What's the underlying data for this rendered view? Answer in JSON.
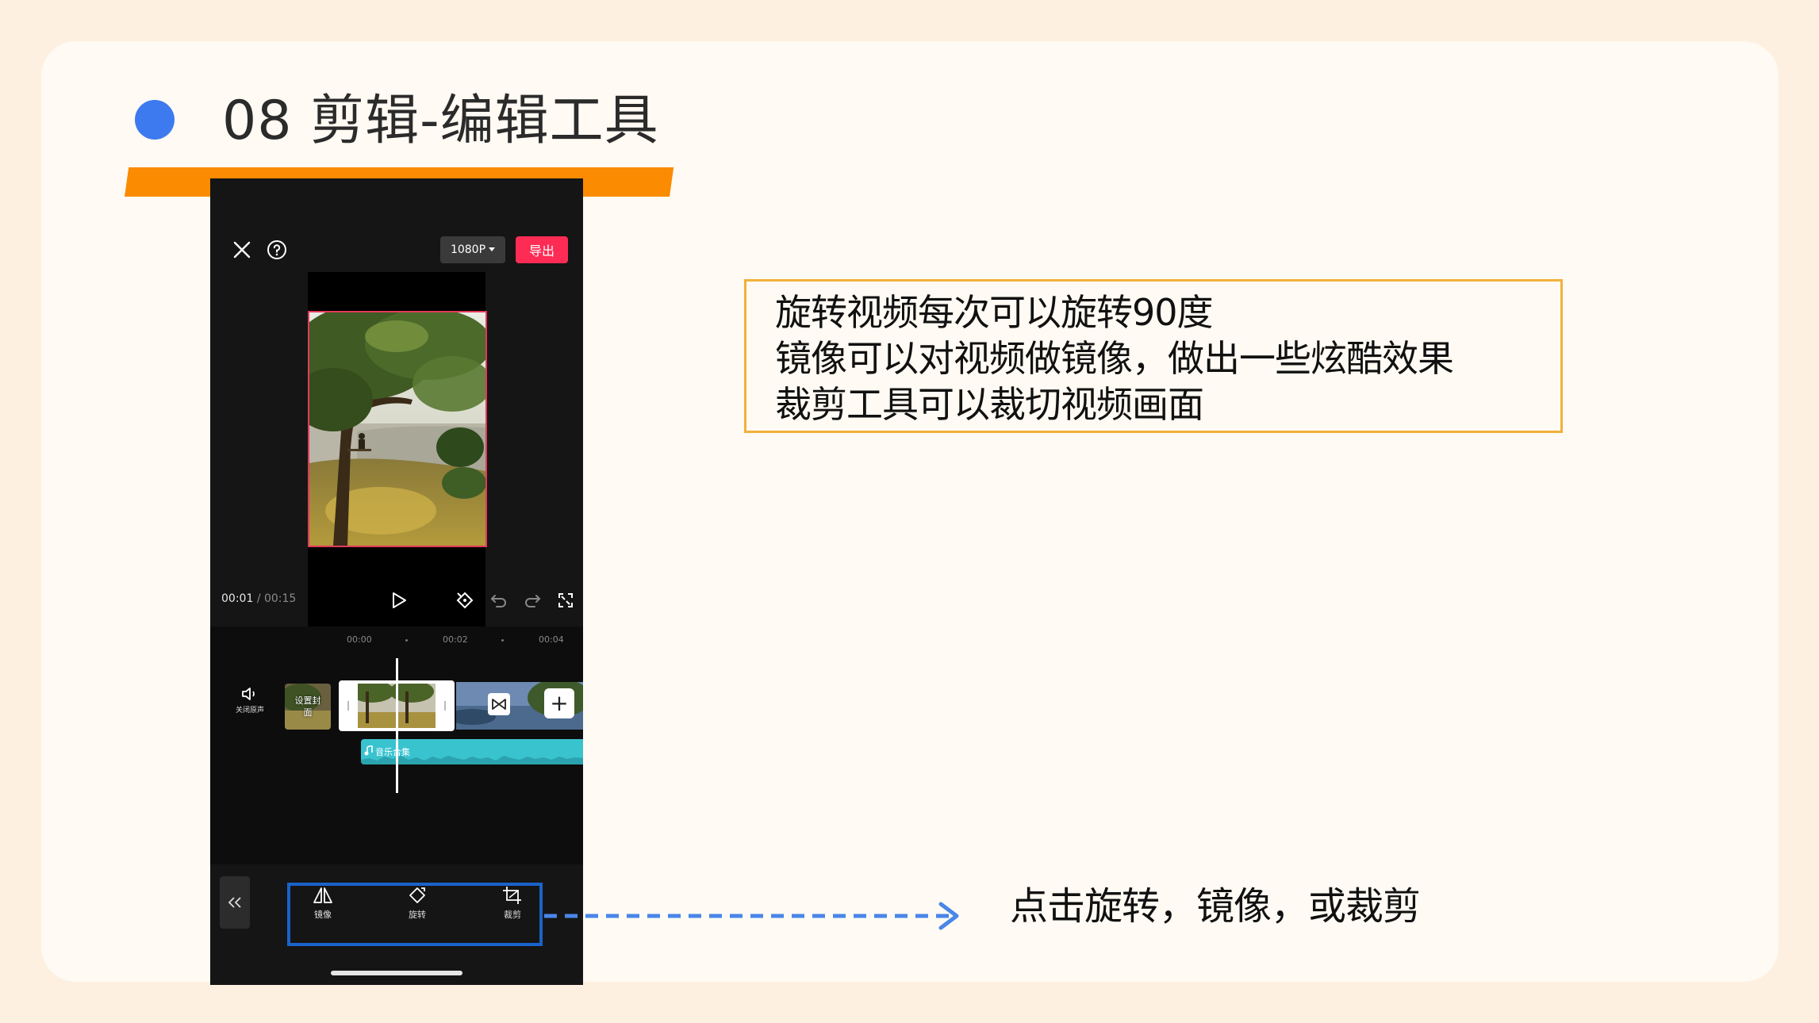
{
  "slide": {
    "title": "08 剪辑-编辑工具",
    "callout_lines": [
      "旋转视频每次可以旋转90度",
      "镜像可以对视频做镜像，做出一些炫酷效果",
      "裁剪工具可以裁切视频画面"
    ],
    "hint": "点击旋转，镜像，或裁剪"
  },
  "colors": {
    "accent_orange": "#fb8b00",
    "accent_blue": "#3d7af0",
    "highlight_blue": "#1a63c9",
    "callout_border": "#f0b13c",
    "export_red": "#fe2c55",
    "audio_teal": "#39c3cf"
  },
  "phone": {
    "topbar": {
      "close_icon": "close-icon",
      "help_icon": "help-circle-icon",
      "resolution": "1080P",
      "export_label": "导出"
    },
    "playback": {
      "current_time": "00:01",
      "separator": "/",
      "total_time": "00:15"
    },
    "timeline": {
      "ruler": [
        "00:00",
        "00:02",
        "00:04"
      ],
      "mute_label": "关闭原声",
      "cover_label": "设置封面",
      "audio_label": "音乐合集"
    },
    "toolbar": {
      "tools": [
        {
          "label": "镜像",
          "icon": "mirror-icon"
        },
        {
          "label": "旋转",
          "icon": "rotate-icon"
        },
        {
          "label": "裁剪",
          "icon": "crop-icon"
        }
      ]
    }
  }
}
